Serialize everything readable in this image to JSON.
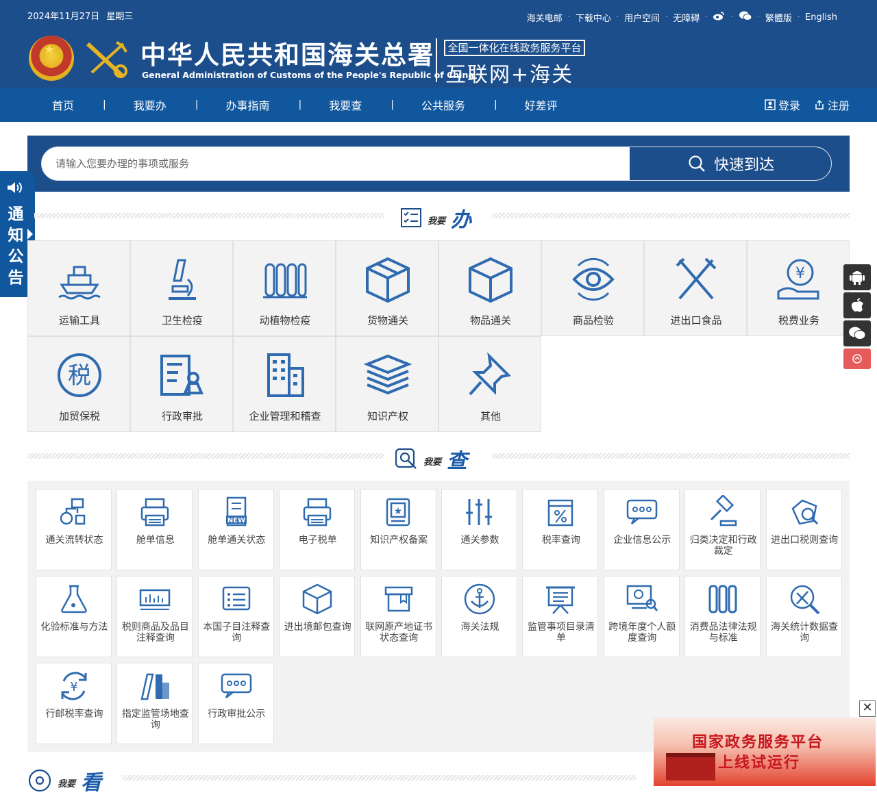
{
  "topbar": {
    "date": "2024年11月27日",
    "weekday": "星期三",
    "links": [
      "海关电邮",
      "下载中心",
      "用户空间",
      "无障碍"
    ],
    "lang_links": [
      "繁體版",
      "English"
    ]
  },
  "brand": {
    "title_cn": "中华人民共和国海关总署",
    "title_en": "General Administration of Customs of the People's Republic of China",
    "platform_box": "全国一体化在线政务服务平台",
    "platform_big": "互联网+海关"
  },
  "nav": {
    "items": [
      "首页",
      "我要办",
      "办事指南",
      "我要查",
      "公共服务",
      "好差评"
    ],
    "login": "登录",
    "register": "注册"
  },
  "search": {
    "placeholder": "请输入您要办理的事项或服务",
    "button": "快速到达"
  },
  "notice": {
    "label": "通知公告"
  },
  "section_ban": {
    "small": "我要",
    "big": "办",
    "items": [
      {
        "label": "运输工具",
        "icon": "ship-icon"
      },
      {
        "label": "卫生检疫",
        "icon": "microscope-icon"
      },
      {
        "label": "动植物检疫",
        "icon": "quarantine-icon"
      },
      {
        "label": "货物通关",
        "icon": "cargo-box-icon"
      },
      {
        "label": "物品通关",
        "icon": "package-icon"
      },
      {
        "label": "商品检验",
        "icon": "eye-inspect-icon"
      },
      {
        "label": "进出口食品",
        "icon": "fork-knife-icon"
      },
      {
        "label": "税费业务",
        "icon": "yuan-hand-icon"
      },
      {
        "label": "加贸保税",
        "icon": "tax-circle-icon"
      },
      {
        "label": "行政审批",
        "icon": "approval-icon"
      },
      {
        "label": "企业管理和稽查",
        "icon": "building-icon"
      },
      {
        "label": "知识产权",
        "icon": "books-icon"
      },
      {
        "label": "其他",
        "icon": "pin-icon"
      }
    ]
  },
  "section_cha": {
    "small": "我要",
    "big": "查",
    "items": [
      {
        "label": "通关流转状态"
      },
      {
        "label": "舱单信息"
      },
      {
        "label": "舱单通关状态"
      },
      {
        "label": "电子税单"
      },
      {
        "label": "知识产权备案"
      },
      {
        "label": "通关参数"
      },
      {
        "label": "税率查询"
      },
      {
        "label": "企业信息公示"
      },
      {
        "label": "归类决定和行政裁定"
      },
      {
        "label": "进出口税则查询"
      },
      {
        "label": "化验标准与方法"
      },
      {
        "label": "税则商品及品目注释查询"
      },
      {
        "label": "本国子目注释查询"
      },
      {
        "label": "进出境邮包查询"
      },
      {
        "label": "联网原产地证书状态查询"
      },
      {
        "label": "海关法规"
      },
      {
        "label": "监管事项目录清单"
      },
      {
        "label": "跨境年度个人额度查询"
      },
      {
        "label": "消费品法律法规与标准"
      },
      {
        "label": "海关统计数据查询"
      },
      {
        "label": "行邮税率查询"
      },
      {
        "label": "指定监管场地查询"
      },
      {
        "label": "行政审批公示"
      }
    ]
  },
  "section_kan": {
    "small": "我要",
    "big": "看"
  },
  "promo": {
    "line1": "国家政务服务平台",
    "line2": "上线试运行"
  },
  "colors": {
    "header_blue": "#1c4e8c",
    "nav_blue": "#11579e",
    "icon_blue": "#2f6bb0"
  }
}
